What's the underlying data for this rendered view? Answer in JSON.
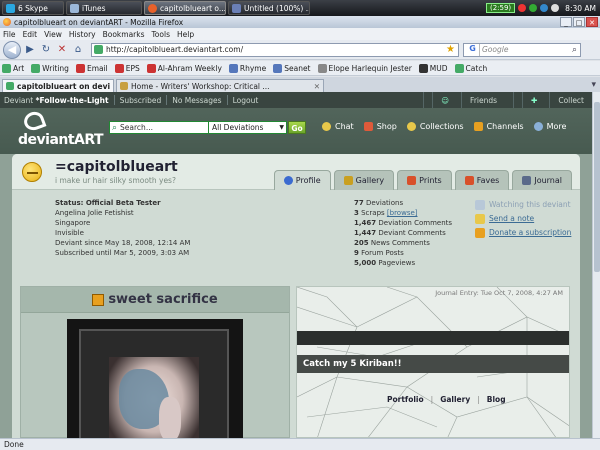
{
  "taskbar": {
    "items": [
      {
        "label": "6 Skype",
        "color": "#2aa7e0"
      },
      {
        "label": "iTunes",
        "color": "#9bb7d8"
      },
      {
        "label": "capitolblueart o...",
        "color": "#e8612a"
      },
      {
        "label": "Untitled (100%) ...",
        "color": "#6a7fb6"
      }
    ],
    "tray_badge": "(2:59)",
    "clock": "8:30 AM"
  },
  "window": {
    "title": "capitolblueart on deviantART - Mozilla Firefox",
    "controls": {
      "minimize": "_",
      "maximize": "□",
      "close": "✕"
    }
  },
  "menu": [
    "File",
    "Edit",
    "View",
    "History",
    "Bookmarks",
    "Tools",
    "Help"
  ],
  "nav": {
    "back_icon": "◀",
    "forward_icon": "▶",
    "reload_icon": "↻",
    "stop_icon": "✕",
    "home_icon": "⌂",
    "url": "http://capitolblueart.deviantart.com/",
    "search_placeholder": "Google",
    "search_engine_glyph": "G"
  },
  "bookmarks": [
    {
      "label": "Art",
      "color": "#4a6"
    },
    {
      "label": "Writing",
      "color": "#4a6"
    },
    {
      "label": "Email",
      "color": "#c33"
    },
    {
      "label": "EPS",
      "color": "#c33"
    },
    {
      "label": "Al-Ahram Weekly",
      "color": "#c33"
    },
    {
      "label": "Rhyme",
      "color": "#5577bb"
    },
    {
      "label": "Seanet",
      "color": "#5577bb"
    },
    {
      "label": "Elope Harlequin Jester",
      "color": "#888"
    },
    {
      "label": "MUD",
      "color": "#333"
    },
    {
      "label": "Catch",
      "color": "#4a6"
    }
  ],
  "tabs": [
    {
      "label": "capitolblueart on deviantART",
      "active": true
    },
    {
      "label": "Home - Writers' Workshop: Critical ...",
      "active": false
    }
  ],
  "da_top": {
    "deviant_prefix": "Deviant",
    "deviant_name": "*Follow-the-Light",
    "subscribed": "Subscribed",
    "messages": "No Messages",
    "logout": "Logout",
    "friends": "Friends",
    "collect": "Collect"
  },
  "da_header": {
    "logo_text": "deviantART",
    "search_placeholder": "Search...",
    "search_scope": "All Deviations",
    "go_label": "Go",
    "links": [
      {
        "label": "Chat",
        "color": "#e8c84a"
      },
      {
        "label": "Shop",
        "color": "#e05a3a"
      },
      {
        "label": "Collections",
        "color": "#e8c84a"
      },
      {
        "label": "Channels",
        "color": "#e8a020"
      },
      {
        "label": "More",
        "color": "#8ab0d8"
      }
    ]
  },
  "profile": {
    "username": "=capitolblueart",
    "tagline": "i make ur hair silky smooth yes?",
    "tabs": [
      {
        "label": "Profile",
        "active": true,
        "color": "#3b6bd0"
      },
      {
        "label": "Gallery",
        "active": false,
        "color": "#c9a020"
      },
      {
        "label": "Prints",
        "active": false,
        "color": "#d8502a"
      },
      {
        "label": "Faves",
        "active": false,
        "color": "#d8502a"
      },
      {
        "label": "Journal",
        "active": false,
        "color": "#5a6a8a"
      }
    ],
    "status": "Status: Official Beta Tester",
    "details": [
      "Angelina Jolie Fetishist",
      "Singapore",
      "Invisible",
      "Deviant since May 18, 2008, 12:14 AM",
      "Subscribed until Mar 5, 2009, 3:03 AM"
    ],
    "stats": [
      {
        "count": "77",
        "label": "Deviations"
      },
      {
        "count": "3",
        "label": "Scraps"
      },
      {
        "count": "1,467",
        "label": "Deviation Comments"
      },
      {
        "count": "1,447",
        "label": "Deviant Comments"
      },
      {
        "count": "205",
        "label": "News Comments"
      },
      {
        "count": "9",
        "label": "Forum Posts"
      },
      {
        "count": "5,000",
        "label": "Pageviews"
      }
    ],
    "browse_label": "[browse]",
    "actions": [
      {
        "label": "Watching this deviant",
        "faded": true,
        "color": "#8ca0b4"
      },
      {
        "label": "Send a note",
        "faded": false,
        "color": "#e8c84a"
      },
      {
        "label": "Donate a subscription",
        "faded": false,
        "color": "#e8a020"
      }
    ]
  },
  "featured": {
    "title": "sweet sacrifice"
  },
  "journal": {
    "meta": "Journal Entry: Tue Oct 7, 2008, 4:27 AM",
    "title": "Catch my 5 Kiriban!!",
    "links": [
      "Portfolio",
      "Gallery",
      "Blog"
    ]
  },
  "statusbar": {
    "text": "Done"
  }
}
